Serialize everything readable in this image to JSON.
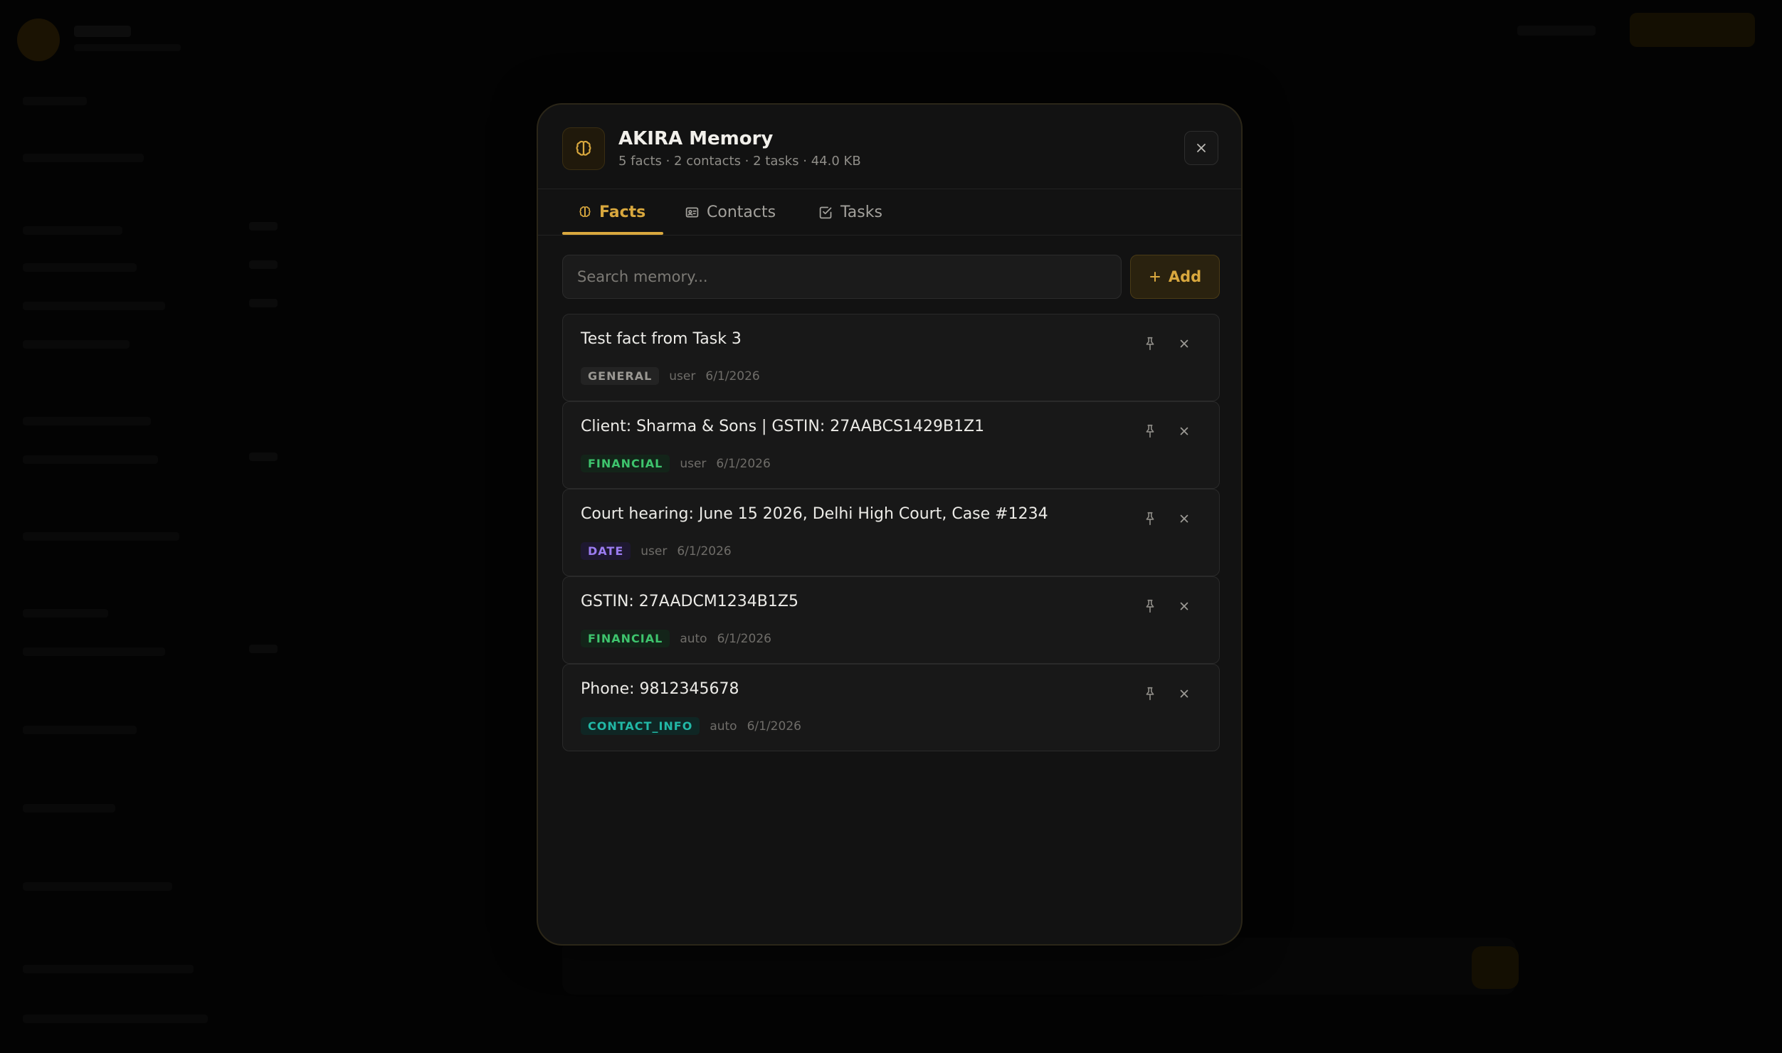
{
  "modal": {
    "title": "AKIRA Memory",
    "subtitle": "5 facts · 2 contacts · 2 tasks · 44.0 KB",
    "tabs": [
      {
        "label": "Facts",
        "icon": "brain-icon",
        "active": true
      },
      {
        "label": "Contacts",
        "icon": "contact-card-icon",
        "active": false
      },
      {
        "label": "Tasks",
        "icon": "checkbox-icon",
        "active": false
      }
    ],
    "search": {
      "placeholder": "Search memory...",
      "value": ""
    },
    "add_label": "Add",
    "facts": [
      {
        "text": "Test fact from Task 3",
        "category": "GENERAL",
        "source": "user",
        "date": "6/1/2026"
      },
      {
        "text": "Client: Sharma & Sons | GSTIN: 27AABCS1429B1Z1",
        "category": "FINANCIAL",
        "source": "user",
        "date": "6/1/2026"
      },
      {
        "text": "Court hearing: June 15 2026, Delhi High Court, Case #1234",
        "category": "DATE",
        "source": "user",
        "date": "6/1/2026"
      },
      {
        "text": "GSTIN: 27AADCM1234B1Z5",
        "category": "FINANCIAL",
        "source": "auto",
        "date": "6/1/2026"
      },
      {
        "text": "Phone: 9812345678",
        "category": "CONTACT_INFO",
        "source": "auto",
        "date": "6/1/2026"
      }
    ]
  },
  "colors": {
    "accent": "#d9a83e",
    "general_tag": "#9a9893",
    "financial_tag": "#3ec46d",
    "date_tag": "#9b7cf0",
    "contact_info_tag": "#22b8a6"
  }
}
